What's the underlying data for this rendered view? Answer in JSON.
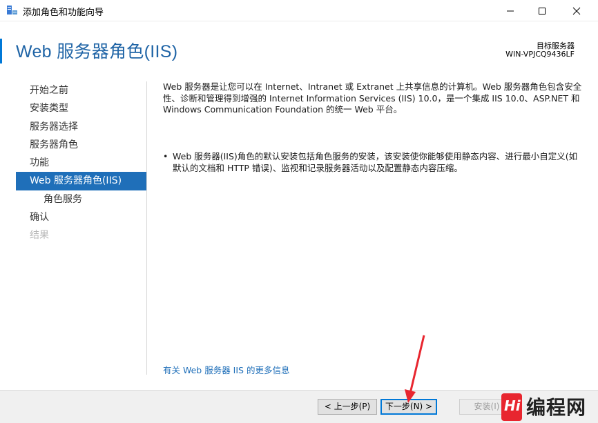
{
  "window": {
    "title": "添加角色和功能向导",
    "icon": "server-manager-icon"
  },
  "header": {
    "page_title": "Web 服务器角色(IIS)",
    "dest_label": "目标服务器",
    "dest_server": "WIN-VPJCQ9436LF"
  },
  "nav": {
    "items": [
      {
        "label": "开始之前",
        "state": "normal"
      },
      {
        "label": "安装类型",
        "state": "normal"
      },
      {
        "label": "服务器选择",
        "state": "normal"
      },
      {
        "label": "服务器角色",
        "state": "normal"
      },
      {
        "label": "功能",
        "state": "normal"
      },
      {
        "label": "Web 服务器角色(IIS)",
        "state": "active"
      },
      {
        "label": "角色服务",
        "state": "sub"
      },
      {
        "label": "确认",
        "state": "normal"
      },
      {
        "label": "结果",
        "state": "disabled"
      }
    ]
  },
  "content": {
    "intro": "Web 服务器是让您可以在 Internet、Intranet 或 Extranet 上共享信息的计算机。Web 服务器角色包含安全性、诊断和管理得到增强的 Internet Information Services (IIS) 10.0，是一个集成 IIS 10.0、ASP.NET 和 Windows Communication Foundation 的统一 Web 平台。",
    "bullet": "Web 服务器(IIS)角色的默认安装包括角色服务的安装，该安装使你能够使用静态内容、进行最小自定义(如默认的文档和 HTTP 错误)、监视和记录服务器活动以及配置静态内容压缩。",
    "more_link": "有关 Web 服务器 IIS 的更多信息"
  },
  "footer": {
    "prev_label": "< 上一步(P)",
    "next_label": "下一步(N) >",
    "install_label": "安装(I)"
  },
  "watermark": {
    "mark": "Hi",
    "text": "编程网"
  },
  "colors": {
    "accent": "#0078d7",
    "title_blue": "#1f64a6",
    "nav_active": "#1f6fb9",
    "annotation_red": "#e8262f"
  }
}
